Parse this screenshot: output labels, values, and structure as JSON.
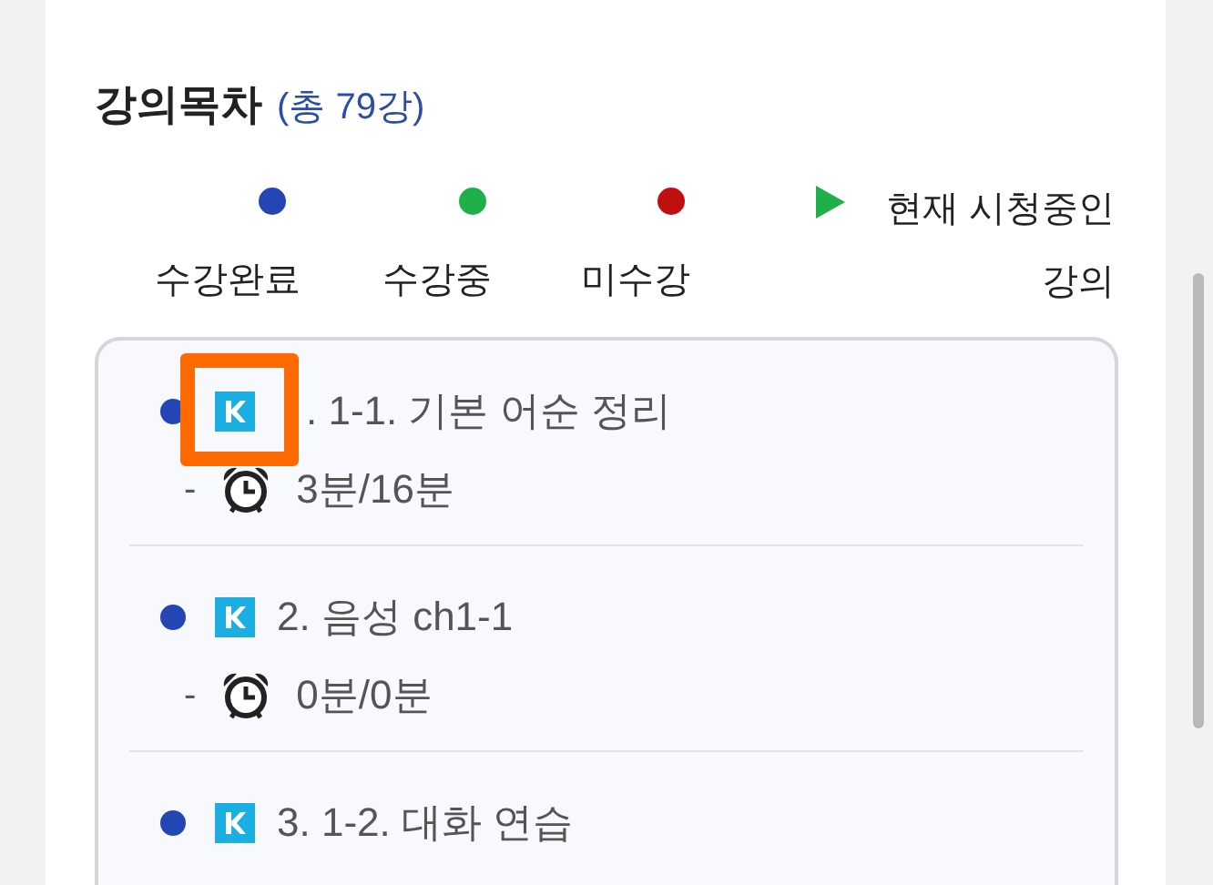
{
  "heading": {
    "title": "강의목차",
    "count": "(총 79강)"
  },
  "legend": [
    {
      "kind": "dot",
      "color": "#2446b5",
      "label": "수강완료"
    },
    {
      "kind": "dot",
      "color": "#1fb04a",
      "label": "수강중"
    },
    {
      "kind": "dot",
      "color": "#c00f0f",
      "label": "미수강"
    },
    {
      "kind": "current",
      "label": "현재 시청중인 강의"
    }
  ],
  "lectures": [
    {
      "color": "#2446b5",
      "title": ". 1-1. 기본 어순 정리",
      "dash": "-",
      "time": "3분/16분",
      "highlighted": true
    },
    {
      "color": "#2446b5",
      "title": "2. 음성 ch1-1",
      "dash": "-",
      "time": "0분/0분",
      "highlighted": false
    },
    {
      "color": "#2446b5",
      "title": "3. 1-2. 대화 연습",
      "highlighted": false
    }
  ]
}
